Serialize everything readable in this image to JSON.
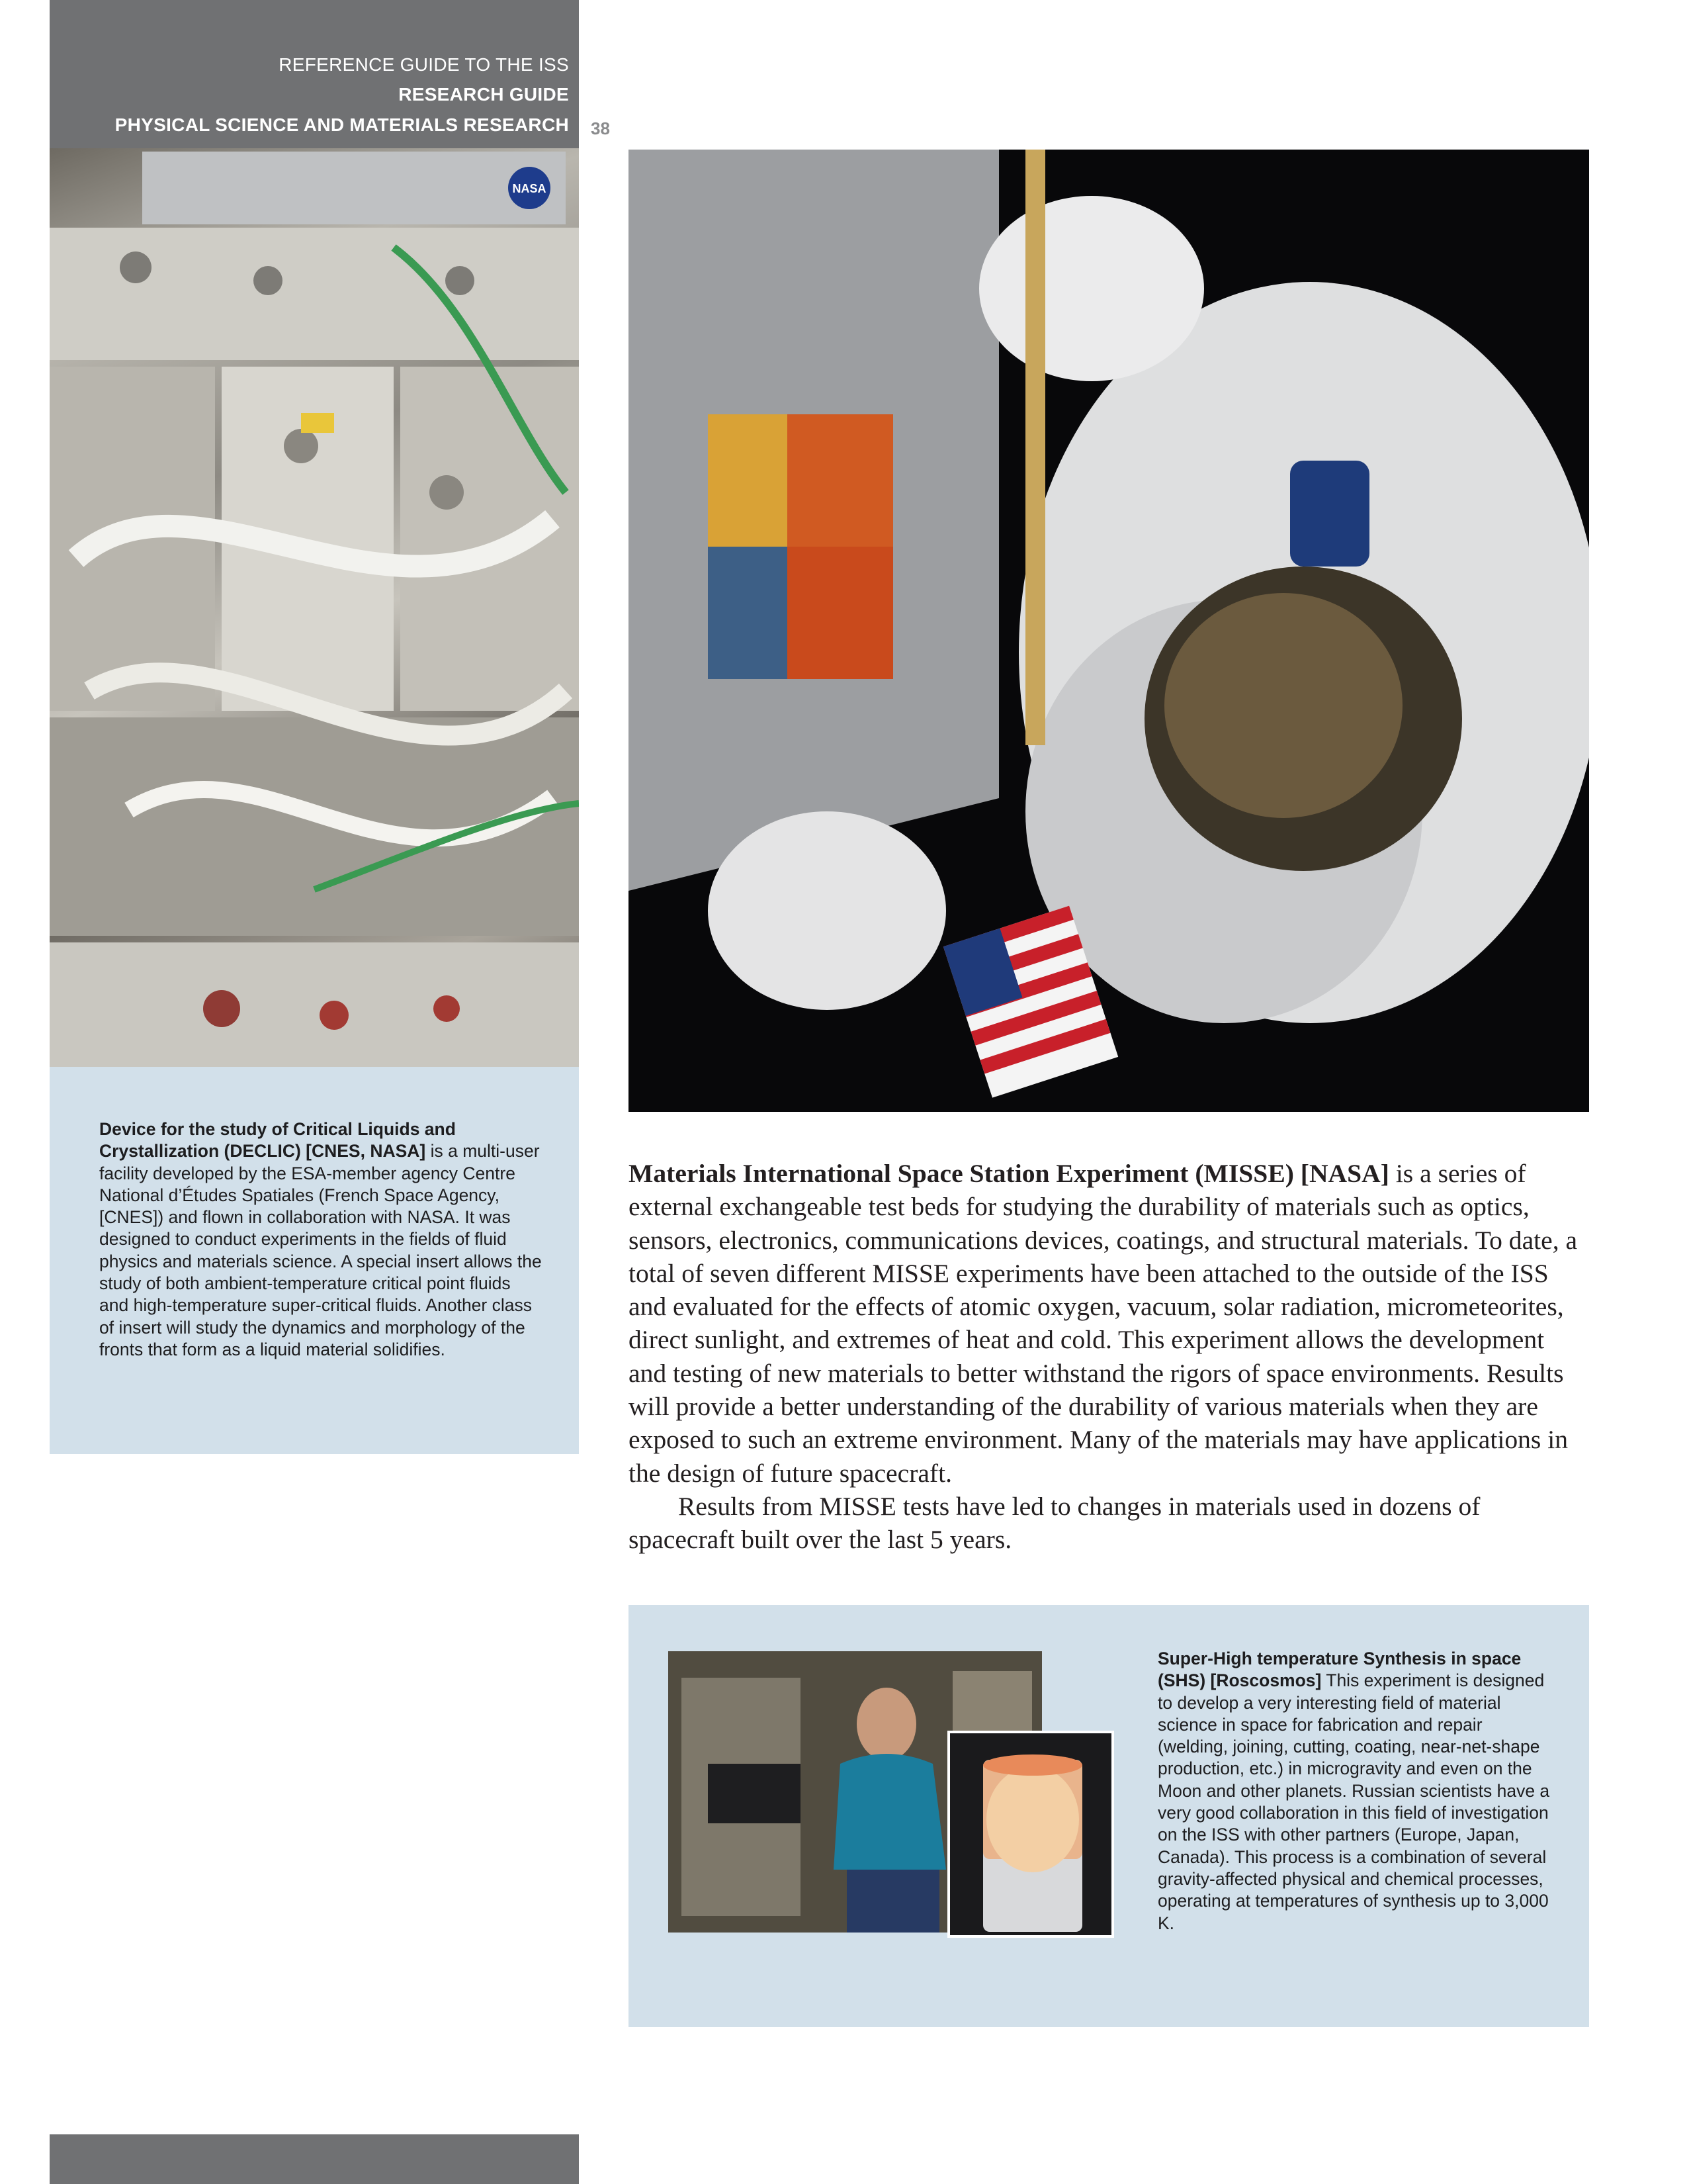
{
  "header": {
    "line1": "REFERENCE GUIDE TO THE ISS",
    "line2": "RESEARCH GUIDE",
    "line3": "PHYSICAL SCIENCE AND MATERIALS RESEARCH",
    "page_number": "38"
  },
  "photos": {
    "declic_logo_text": "NASA"
  },
  "declic": {
    "title": "Device for the study of Critical Liquids and Crystallization (DECLIC) [CNES, NASA]",
    "body": " is a multi-user facility developed by the ESA-member agency Centre National d’Études Spatiales (French Space Agency, [CNES]) and flown in collaboration with NASA. It was designed to conduct experiments in the fields of fluid physics and materials science. A special insert allows the study of both ambient-temperature critical point fluids and high-temperature super-critical fluids. Another class of insert will study the dynamics and morphology of the fronts that form as a liquid material solidifies."
  },
  "misse": {
    "title": "Materials International Space Station Experiment (MISSE) [NASA]",
    "paragraph1": " is a series of external exchangeable test beds for studying the durability of materials such as optics, sensors, electronics, communications devices, coatings, and structural materials. To date, a total of seven different MISSE experiments have been attached to the outside of the ISS and evaluated for the effects of atomic oxygen, vacuum, solar radiation, micrometeorites, direct sunlight, and extremes of heat and cold. This experiment allows the development and testing of new materials to better withstand the rigors of space environments. Results will provide a better understanding of the durability of various materials when they are exposed to such an extreme environment. Many of the materials may have applications in the design of future spacecraft.",
    "paragraph2": "Results from MISSE tests have led to changes in materials used in dozens of spacecraft built over the last 5 years."
  },
  "shs": {
    "title": "Super-High temperature Synthesis in space (SHS) [Roscosmos]",
    "body": " This experiment is designed to develop a very interesting field of material science in space for fabrication and repair (welding, joining, cutting, coating, near-net-shape production, etc.) in microgravity and even on the Moon and other planets. Russian scientists have a very good collaboration in this field of investigation on the ISS with other partners (Europe, Japan, Canada). This process is a combination of several gravity-affected physical and chemical processes, operating at temperatures of synthesis up to 3,000 K."
  },
  "colors": {
    "header_gray": "#707173",
    "caption_box_blue": "#d2e0ea",
    "body_text": "#231f20"
  }
}
